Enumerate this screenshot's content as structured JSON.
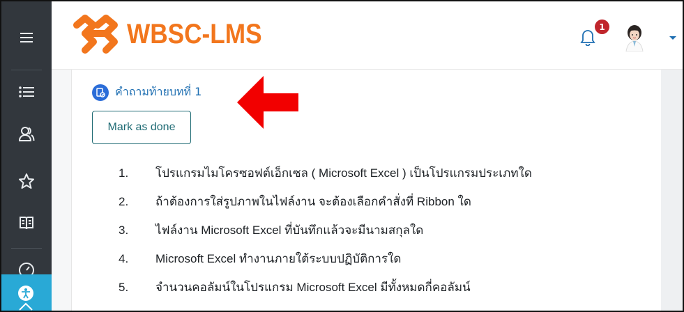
{
  "header": {
    "brand": "WBSC-LMS",
    "notification_count": "1",
    "icons": [
      "menu-icon",
      "bell-icon",
      "avatar",
      "chevron-down-icon"
    ]
  },
  "sidebar": {
    "items": [
      {
        "name": "menu-icon"
      },
      {
        "name": "list-icon"
      },
      {
        "name": "users-icon"
      },
      {
        "name": "star-icon"
      },
      {
        "name": "book-icon"
      },
      {
        "name": "dashboard-icon"
      },
      {
        "name": "accessibility-icon"
      }
    ]
  },
  "activity": {
    "title": "คำถามท้ายบทที่ 1",
    "mark_done_label": "Mark as done"
  },
  "questions": [
    {
      "num": "1.",
      "text": "โปรแกรมไมโครซอฟต์เอ็กเซล ( Microsoft Excel ) เป็นโปรแกรมประเภทใด"
    },
    {
      "num": "2.",
      "text": "ถ้าต้องการใส่รูปภาพในไฟล์งาน จะต้องเลือกคำสั่งที่ Ribbon ใด"
    },
    {
      "num": "3.",
      "text": "ไฟล์งาน Microsoft Excel ที่บันทึกแล้วจะมีนามสกุลใด"
    },
    {
      "num": "4.",
      "text": "Microsoft Excel ทำงานภายใต้ระบบปฏิบัติการใด"
    },
    {
      "num": "5.",
      "text": "จำนวนคอลัมน์ในโปรแกรม Microsoft Excel มีทั้งหมดกี่คอลัมน์"
    }
  ],
  "colors": {
    "sidebar": "#32373d",
    "brand": "#f2761d",
    "link": "#1f6fb2",
    "badge": "#c0262c",
    "accessibility": "#29a9d6",
    "arrow": "#f20000"
  }
}
